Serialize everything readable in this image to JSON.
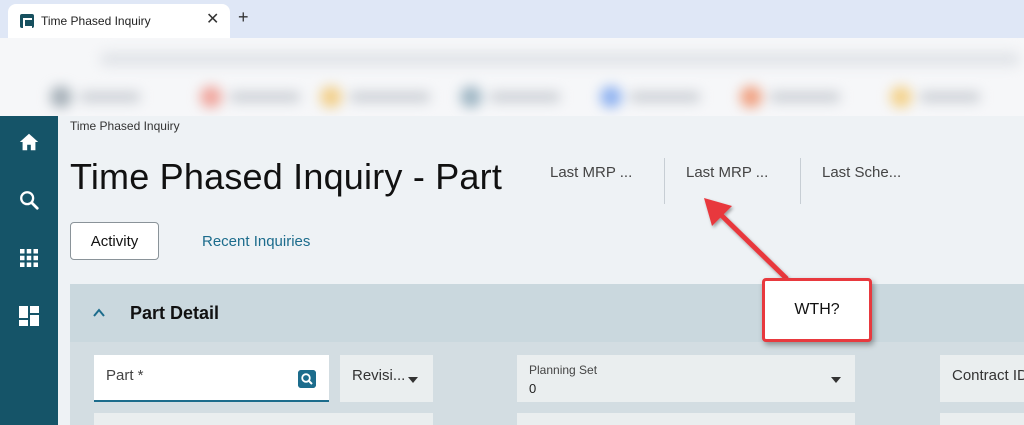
{
  "browser": {
    "tab_title": "Time Phased Inquiry",
    "close_glyph": "✕",
    "new_tab_glyph": "+"
  },
  "rail": {
    "items": [
      {
        "name": "home-icon"
      },
      {
        "name": "search-icon"
      },
      {
        "name": "apps-grid-icon"
      },
      {
        "name": "dashboard-icon"
      }
    ],
    "color": "#155468"
  },
  "page": {
    "breadcrumb": "Time Phased Inquiry",
    "title": "Time Phased Inquiry - Part",
    "meta": [
      "Last MRP ...",
      "Last MRP ...",
      "Last Sche..."
    ],
    "activity_button": "Activity",
    "recent_link": "Recent Inquiries"
  },
  "section": {
    "title": "Part Detail",
    "fields": {
      "part_label": "Part *",
      "revision_label": "Revisi...",
      "planning_label": "Planning Set",
      "planning_value": "0",
      "contract_label": "Contract ID"
    }
  },
  "annotation": {
    "text": "WTH?",
    "color": "#e8393e"
  },
  "colors": {
    "accent": "#1c6c8c",
    "rail": "#155468"
  }
}
